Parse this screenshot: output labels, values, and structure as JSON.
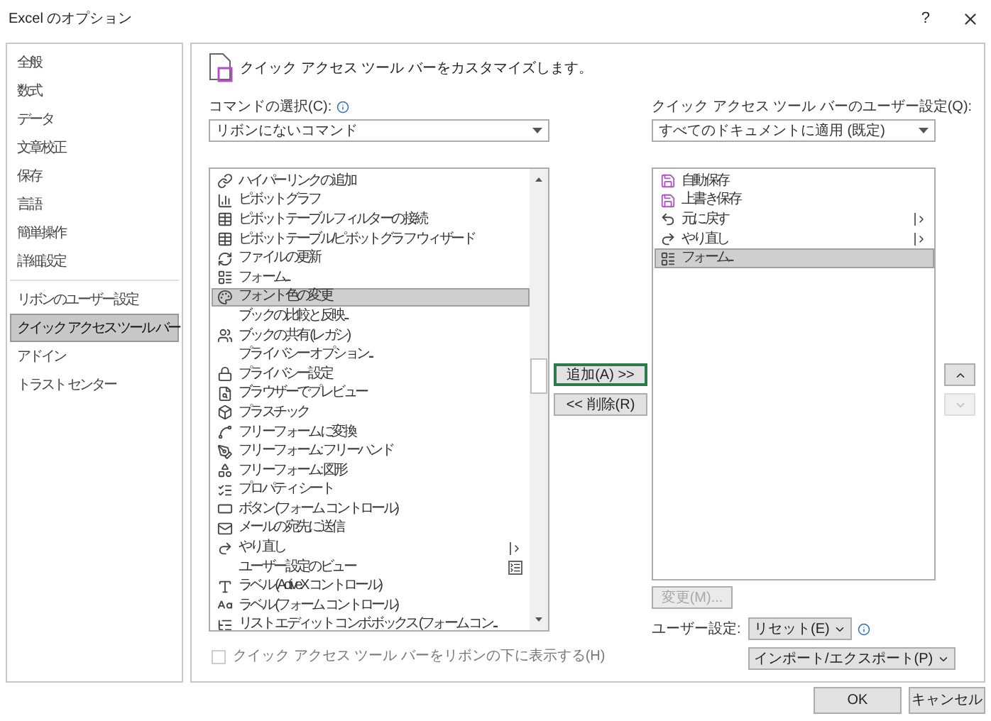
{
  "window": {
    "title": "Excel のオプション",
    "help": "?"
  },
  "sidebar": {
    "sections": [
      [
        {
          "label": "全般",
          "selected": false
        },
        {
          "label": "数式",
          "selected": false
        },
        {
          "label": "データ",
          "selected": false
        },
        {
          "label": "文章校正",
          "selected": false
        },
        {
          "label": "保存",
          "selected": false
        },
        {
          "label": "言語",
          "selected": false
        },
        {
          "label": "簡単操作",
          "selected": false
        },
        {
          "label": "詳細設定",
          "selected": false
        }
      ],
      [
        {
          "label": "リボンのユーザー設定",
          "selected": false
        },
        {
          "label": "クイック アクセス ツール バー",
          "selected": true
        },
        {
          "label": "アドイン",
          "selected": false
        },
        {
          "label": "トラスト センター",
          "selected": false
        }
      ]
    ]
  },
  "header": "クイック アクセス ツール バーをカスタマイズします。",
  "commands": {
    "label": "コマンドの選択(C):",
    "dropdown": "リボンにないコマンド",
    "items": [
      {
        "label": "ハイパーリンクの追加",
        "selected": false,
        "kind": "plain"
      },
      {
        "label": "ピボットグラフ",
        "selected": false,
        "kind": "plain"
      },
      {
        "label": "ピボットテーブル フィルターの接続",
        "selected": false,
        "kind": "plain"
      },
      {
        "label": "ピボットテーブル/ピボットグラフ ウィザード",
        "selected": false,
        "kind": "plain"
      },
      {
        "label": "ファイルの更新",
        "selected": false,
        "kind": "plain"
      },
      {
        "label": "フォーム...",
        "selected": false,
        "kind": "plain"
      },
      {
        "label": "フォント色の変更",
        "selected": true,
        "kind": "plain"
      },
      {
        "label": "ブックの比較と反映...",
        "selected": false,
        "kind": "plain"
      },
      {
        "label": "ブックの共有 (レガシ)",
        "selected": false,
        "kind": "plain"
      },
      {
        "label": "プライバシー オプション...",
        "selected": false,
        "kind": "plain"
      },
      {
        "label": "プライバシー設定",
        "selected": false,
        "kind": "plain"
      },
      {
        "label": "ブラウザーでプレビュー",
        "selected": false,
        "kind": "plain"
      },
      {
        "label": "プラスチック",
        "selected": false,
        "kind": "plain"
      },
      {
        "label": "フリーフォームに変換",
        "selected": false,
        "kind": "plain"
      },
      {
        "label": "フリーフォーム: フリーハンド",
        "selected": false,
        "kind": "plain"
      },
      {
        "label": "フリーフォーム: 図形",
        "selected": false,
        "kind": "plain"
      },
      {
        "label": "プロパティ シート",
        "selected": false,
        "kind": "plain"
      },
      {
        "label": "ボタン (フォーム コントロール)",
        "selected": false,
        "kind": "plain"
      },
      {
        "label": "メールの宛先に送信",
        "selected": false,
        "kind": "plain"
      },
      {
        "label": "やり直し",
        "selected": false,
        "kind": "submenu"
      },
      {
        "label": "ユーザー設定のビュー",
        "selected": false,
        "kind": "split"
      },
      {
        "label": "ラベル (ActiveX コントロール)",
        "selected": false,
        "kind": "plain"
      },
      {
        "label": "ラベル (フォーム コントロール)",
        "selected": false,
        "kind": "plain"
      },
      {
        "label": "リスト エディット コンボ ボックス (フォーム コン...",
        "selected": false,
        "kind": "plain"
      }
    ],
    "checkbox": {
      "label": "クイック アクセス ツール バーをリボンの下に表示する(H)",
      "checked": false,
      "disabled": true
    }
  },
  "transfer": {
    "add": {
      "label": "追加(A) >>",
      "focused": true
    },
    "remove": {
      "label": "<< 削除(R)",
      "focused": false
    }
  },
  "toolbar": {
    "label": "クイック アクセス ツール バーのユーザー設定(Q):",
    "dropdown": "すべてのドキュメントに適用 (既定)",
    "items": [
      {
        "label": "自動保存",
        "selected": false,
        "kind": "plain"
      },
      {
        "label": "上書き保存",
        "selected": false,
        "kind": "plain"
      },
      {
        "label": "元に戻す",
        "selected": false,
        "kind": "submenu"
      },
      {
        "label": "やり直し",
        "selected": false,
        "kind": "submenu"
      },
      {
        "label": "フォーム...",
        "selected": true,
        "kind": "plain"
      }
    ],
    "move_up": {
      "disabled": false
    },
    "move_down": {
      "disabled": true
    },
    "modify": {
      "label": "変更(M)...",
      "disabled": true
    },
    "user_settings_label": "ユーザー設定:",
    "reset": "リセット(E)",
    "import_export": "インポート/エクスポート(P)"
  },
  "buttons": {
    "ok": "OK",
    "cancel": "キャンセル"
  }
}
